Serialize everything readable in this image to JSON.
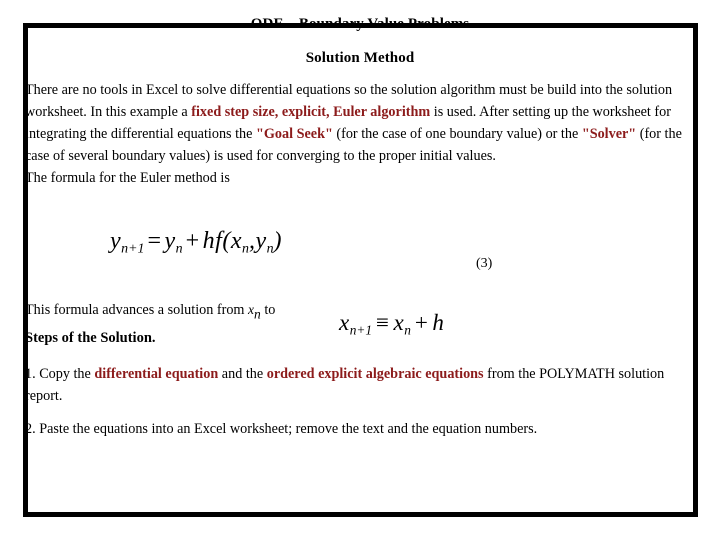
{
  "slide": {
    "title": "ODE – Boundary Value Problems",
    "subtitle": "Solution Method",
    "accent_color": "#8C1B1B",
    "border_color": "#000000",
    "background_color": "#FFFFFF"
  },
  "intro": {
    "t1": "There are no tools in Excel to solve differential equations so the solution algorithm must be build into the solution worksheet. In this example a ",
    "accent1": "fixed step size, explicit, Euler algorithm",
    "t2": " is used. After setting up the worksheet for integrating the differential equations the ",
    "accent2": "\"Goal Seek\"",
    "t3": " (for the case of one boundary value) or the ",
    "accent3": "\"Solver\"",
    "t4": " (for the case of several boundary values) is used for converging to the proper initial values.",
    "t5": "The formula for the Euler method is"
  },
  "equation_1": {
    "lhs_var": "y",
    "lhs_sub": "n+1",
    "equals": "=",
    "rhs_var": "y",
    "rhs_sub": "n",
    "plus": "+",
    "h": "h",
    "f": "f",
    "open_paren": "(",
    "arg1_var": "x",
    "arg1_sub": "n",
    "comma": ",",
    "arg2_var": "y",
    "arg2_sub": "n",
    "close_paren": ")",
    "number": "(3)"
  },
  "advances": {
    "t1": "This formula advances a solution from ",
    "var": "x",
    "sub": "n",
    "t2": " to"
  },
  "equation_2": {
    "lhs_var": "x",
    "lhs_sub": "n+1",
    "equiv": "≡",
    "rhs_var": "x",
    "rhs_sub": "n",
    "plus": "+",
    "h": "h"
  },
  "steps": {
    "heading": "Steps of the Solution.",
    "step1": {
      "t1": "1. Copy the ",
      "accent1": "differential equation",
      "t2": " and the ",
      "accent2": "ordered explicit algebraic equations",
      "t3": " from the POLYMATH solution report."
    },
    "step2": {
      "t1": "2. Paste the equations into an Excel worksheet; remove the text and the equation numbers."
    }
  }
}
